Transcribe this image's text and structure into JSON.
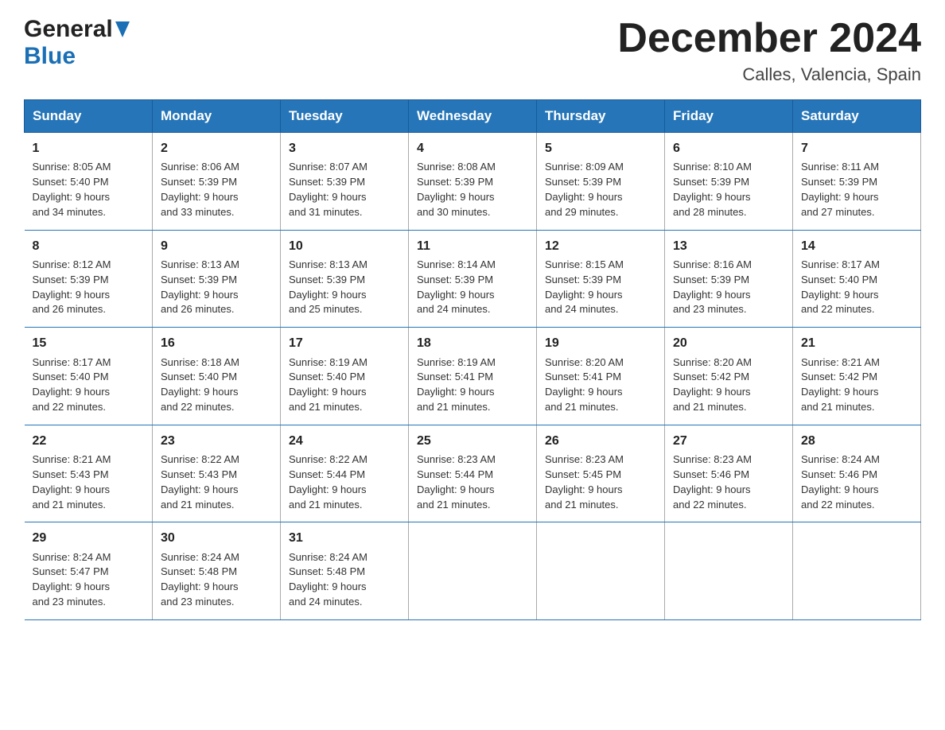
{
  "header": {
    "title": "December 2024",
    "location": "Calles, Valencia, Spain",
    "logo_general": "General",
    "logo_blue": "Blue"
  },
  "columns": [
    "Sunday",
    "Monday",
    "Tuesday",
    "Wednesday",
    "Thursday",
    "Friday",
    "Saturday"
  ],
  "weeks": [
    [
      {
        "day": "1",
        "sunrise": "8:05 AM",
        "sunset": "5:40 PM",
        "daylight": "9 hours and 34 minutes."
      },
      {
        "day": "2",
        "sunrise": "8:06 AM",
        "sunset": "5:39 PM",
        "daylight": "9 hours and 33 minutes."
      },
      {
        "day": "3",
        "sunrise": "8:07 AM",
        "sunset": "5:39 PM",
        "daylight": "9 hours and 31 minutes."
      },
      {
        "day": "4",
        "sunrise": "8:08 AM",
        "sunset": "5:39 PM",
        "daylight": "9 hours and 30 minutes."
      },
      {
        "day": "5",
        "sunrise": "8:09 AM",
        "sunset": "5:39 PM",
        "daylight": "9 hours and 29 minutes."
      },
      {
        "day": "6",
        "sunrise": "8:10 AM",
        "sunset": "5:39 PM",
        "daylight": "9 hours and 28 minutes."
      },
      {
        "day": "7",
        "sunrise": "8:11 AM",
        "sunset": "5:39 PM",
        "daylight": "9 hours and 27 minutes."
      }
    ],
    [
      {
        "day": "8",
        "sunrise": "8:12 AM",
        "sunset": "5:39 PM",
        "daylight": "9 hours and 26 minutes."
      },
      {
        "day": "9",
        "sunrise": "8:13 AM",
        "sunset": "5:39 PM",
        "daylight": "9 hours and 26 minutes."
      },
      {
        "day": "10",
        "sunrise": "8:13 AM",
        "sunset": "5:39 PM",
        "daylight": "9 hours and 25 minutes."
      },
      {
        "day": "11",
        "sunrise": "8:14 AM",
        "sunset": "5:39 PM",
        "daylight": "9 hours and 24 minutes."
      },
      {
        "day": "12",
        "sunrise": "8:15 AM",
        "sunset": "5:39 PM",
        "daylight": "9 hours and 24 minutes."
      },
      {
        "day": "13",
        "sunrise": "8:16 AM",
        "sunset": "5:39 PM",
        "daylight": "9 hours and 23 minutes."
      },
      {
        "day": "14",
        "sunrise": "8:17 AM",
        "sunset": "5:40 PM",
        "daylight": "9 hours and 22 minutes."
      }
    ],
    [
      {
        "day": "15",
        "sunrise": "8:17 AM",
        "sunset": "5:40 PM",
        "daylight": "9 hours and 22 minutes."
      },
      {
        "day": "16",
        "sunrise": "8:18 AM",
        "sunset": "5:40 PM",
        "daylight": "9 hours and 22 minutes."
      },
      {
        "day": "17",
        "sunrise": "8:19 AM",
        "sunset": "5:40 PM",
        "daylight": "9 hours and 21 minutes."
      },
      {
        "day": "18",
        "sunrise": "8:19 AM",
        "sunset": "5:41 PM",
        "daylight": "9 hours and 21 minutes."
      },
      {
        "day": "19",
        "sunrise": "8:20 AM",
        "sunset": "5:41 PM",
        "daylight": "9 hours and 21 minutes."
      },
      {
        "day": "20",
        "sunrise": "8:20 AM",
        "sunset": "5:42 PM",
        "daylight": "9 hours and 21 minutes."
      },
      {
        "day": "21",
        "sunrise": "8:21 AM",
        "sunset": "5:42 PM",
        "daylight": "9 hours and 21 minutes."
      }
    ],
    [
      {
        "day": "22",
        "sunrise": "8:21 AM",
        "sunset": "5:43 PM",
        "daylight": "9 hours and 21 minutes."
      },
      {
        "day": "23",
        "sunrise": "8:22 AM",
        "sunset": "5:43 PM",
        "daylight": "9 hours and 21 minutes."
      },
      {
        "day": "24",
        "sunrise": "8:22 AM",
        "sunset": "5:44 PM",
        "daylight": "9 hours and 21 minutes."
      },
      {
        "day": "25",
        "sunrise": "8:23 AM",
        "sunset": "5:44 PM",
        "daylight": "9 hours and 21 minutes."
      },
      {
        "day": "26",
        "sunrise": "8:23 AM",
        "sunset": "5:45 PM",
        "daylight": "9 hours and 21 minutes."
      },
      {
        "day": "27",
        "sunrise": "8:23 AM",
        "sunset": "5:46 PM",
        "daylight": "9 hours and 22 minutes."
      },
      {
        "day": "28",
        "sunrise": "8:24 AM",
        "sunset": "5:46 PM",
        "daylight": "9 hours and 22 minutes."
      }
    ],
    [
      {
        "day": "29",
        "sunrise": "8:24 AM",
        "sunset": "5:47 PM",
        "daylight": "9 hours and 23 minutes."
      },
      {
        "day": "30",
        "sunrise": "8:24 AM",
        "sunset": "5:48 PM",
        "daylight": "9 hours and 23 minutes."
      },
      {
        "day": "31",
        "sunrise": "8:24 AM",
        "sunset": "5:48 PM",
        "daylight": "9 hours and 24 minutes."
      },
      {
        "day": "",
        "sunrise": "",
        "sunset": "",
        "daylight": ""
      },
      {
        "day": "",
        "sunrise": "",
        "sunset": "",
        "daylight": ""
      },
      {
        "day": "",
        "sunrise": "",
        "sunset": "",
        "daylight": ""
      },
      {
        "day": "",
        "sunrise": "",
        "sunset": "",
        "daylight": ""
      }
    ]
  ],
  "sunrise_label": "Sunrise:",
  "sunset_label": "Sunset:",
  "daylight_label": "Daylight:"
}
